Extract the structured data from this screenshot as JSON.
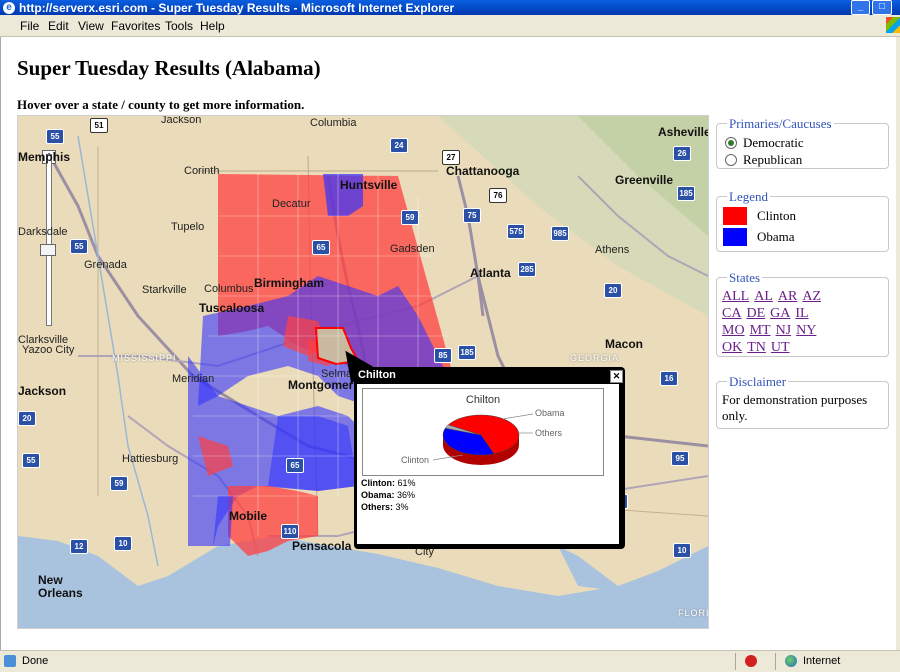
{
  "window": {
    "title": "http://serverx.esri.com - Super Tuesday Results - Microsoft Internet Explorer",
    "minimize": "_",
    "maximize": "□"
  },
  "menu": [
    "File",
    "Edit",
    "View",
    "Favorites",
    "Tools",
    "Help"
  ],
  "page": {
    "title": "Super Tuesday Results (Alabama)",
    "instruction": "Hover over a state / county to get more information."
  },
  "map": {
    "city_labels": [
      "Memphis",
      "Jackson",
      "Columbia",
      "Asheville",
      "Corinth",
      "Huntsville",
      "Chattanooga",
      "Greenville",
      "Decatur",
      "Tupelo",
      "Gadsden",
      "Athens",
      "Grenada",
      "Starkville",
      "Columbus",
      "Birmingham",
      "Atlanta",
      "Tuscaloosa",
      "Macon",
      "Yazoo City",
      "Jackson",
      "Meridian",
      "Montgomery",
      "Selma",
      "Hattiesburg",
      "Mobile",
      "Pensacola",
      "New Orleans",
      "Darksdale",
      "Clarksville",
      "City"
    ],
    "state_labels": [
      "MISSISSIPPI",
      "GEORGIA",
      "FLORIDA"
    ],
    "watermark": "FLORIDA"
  },
  "popup": {
    "county": "Chilton",
    "close": "✕",
    "chart_title": "Chilton",
    "stats": [
      {
        "label": "Clinton:",
        "value": "61%"
      },
      {
        "label": "Obama:",
        "value": "36%"
      },
      {
        "label": "Others:",
        "value": "3%"
      }
    ]
  },
  "chart_data": {
    "type": "pie",
    "title": "Chilton",
    "categories": [
      "Clinton",
      "Obama",
      "Others"
    ],
    "values": [
      61,
      36,
      3
    ],
    "colors": [
      "#ff0000",
      "#0000ff",
      "#aaaaaa"
    ]
  },
  "panels": {
    "primaries": {
      "title": "Primaries/Caucuses",
      "options": [
        "Democratic",
        "Republican"
      ],
      "selected": "Democratic"
    },
    "legend": {
      "title": "Legend",
      "items": [
        {
          "label": "Clinton",
          "color": "#ff0000"
        },
        {
          "label": "Obama",
          "color": "#0000ff"
        }
      ]
    },
    "states": {
      "title": "States",
      "links": [
        "ALL",
        "AL",
        "AR",
        "AZ",
        "CA",
        "DE",
        "GA",
        "IL",
        "MO",
        "MT",
        "NJ",
        "NY",
        "OK",
        "TN",
        "UT"
      ]
    },
    "disclaimer": {
      "title": "Disclaimer",
      "text": "For demonstration purposes only."
    }
  },
  "status": {
    "left": "Done",
    "zone": "Internet"
  }
}
